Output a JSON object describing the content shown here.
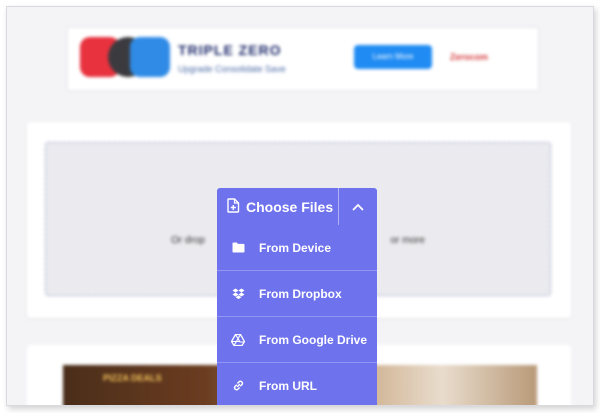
{
  "ad_top": {
    "title": "TRIPLE ZERO",
    "subtitle": "Upgrade  Consolidate  Save",
    "cta": "Learn More",
    "brand": "Zerocom"
  },
  "dropzone": {
    "text_left": "Or drop",
    "text_right": "or more"
  },
  "uploader": {
    "choose_label": "Choose Files",
    "menu": [
      {
        "label": "From Device",
        "icon": "folder-icon"
      },
      {
        "label": "From Dropbox",
        "icon": "dropbox-icon"
      },
      {
        "label": "From Google Drive",
        "icon": "google-drive-icon"
      },
      {
        "label": "From URL",
        "icon": "link-icon"
      }
    ]
  },
  "ad_bottom": {
    "text": "PIZZA DEALS"
  },
  "colors": {
    "accent": "#6e72ec",
    "dropzone_border": "#9c9cc9"
  }
}
